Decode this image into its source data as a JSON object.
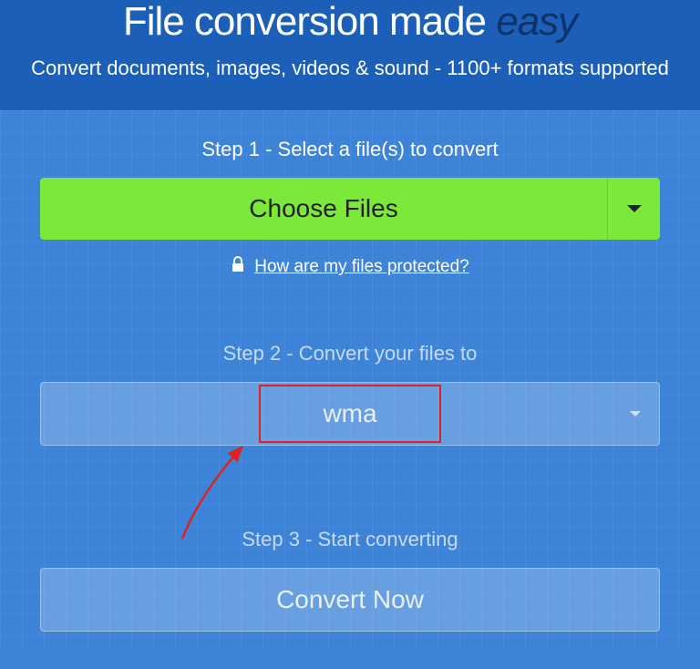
{
  "header": {
    "title_prefix": "File conversion made ",
    "title_emphasis": "easy",
    "subtitle": "Convert documents, images, videos & sound - 1100+ formats supported"
  },
  "step1": {
    "label": "Step 1 - Select a file(s) to convert",
    "choose_button": "Choose Files",
    "protected_link": "How are my files protected?"
  },
  "step2": {
    "label": "Step 2 - Convert your files to",
    "selected_format": "wma"
  },
  "step3": {
    "label": "Step 3 - Start converting",
    "convert_button": "Convert Now"
  }
}
